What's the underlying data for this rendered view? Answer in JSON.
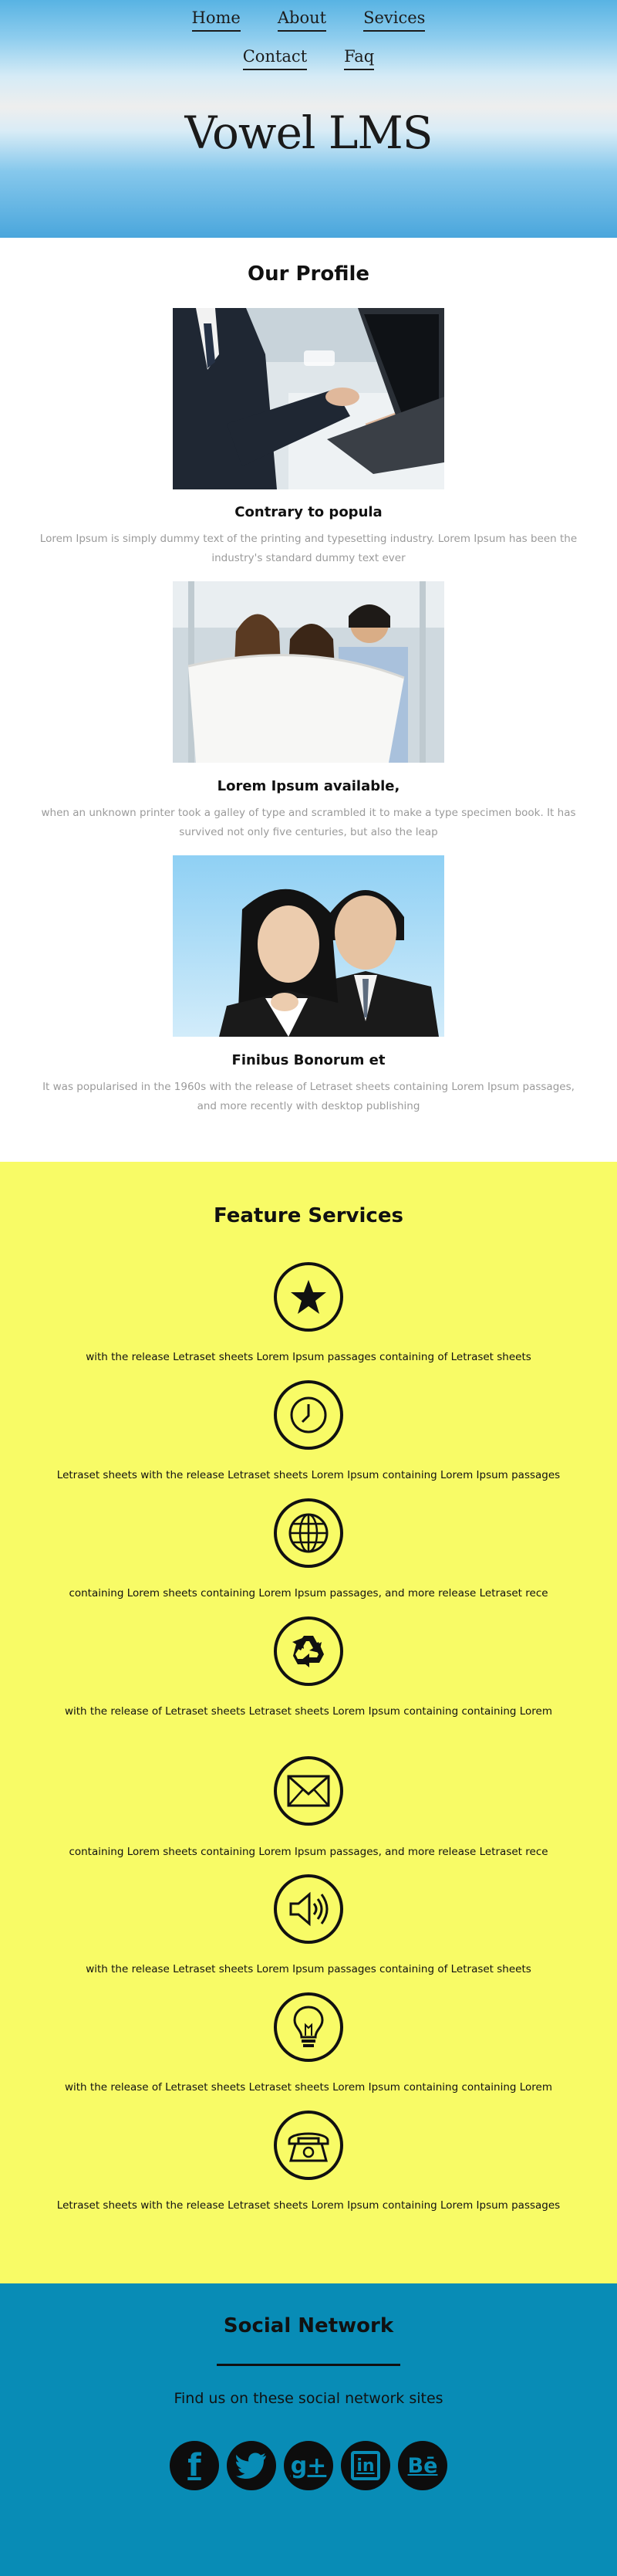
{
  "nav": {
    "row1": [
      {
        "label": "Home"
      },
      {
        "label": "About"
      },
      {
        "label": "Sevices"
      }
    ],
    "row2": [
      {
        "label": "Contact"
      },
      {
        "label": "Faq"
      }
    ]
  },
  "brand": {
    "title": "Vowel LMS"
  },
  "profile": {
    "title": "Our Profile",
    "items": [
      {
        "title": "Contrary to popula",
        "text": "Lorem Ipsum is simply dummy text of the printing and typesetting industry. Lorem Ipsum has been the industry's standard dummy text ever"
      },
      {
        "title": "Lorem Ipsum available,",
        "text": "when an unknown printer took a galley of type and scrambled it to make a type specimen book. It has survived not only five centuries, but also the leap"
      },
      {
        "title": "Finibus Bonorum et",
        "text": "It was popularised in the 1960s with the release of Letraset sheets containing Lorem Ipsum passages, and more recently with desktop publishing"
      }
    ]
  },
  "features": {
    "title": "Feature Services",
    "items": [
      {
        "icon": "star-icon",
        "text": "with the release Letraset sheets Lorem Ipsum passages containing of Letraset sheets"
      },
      {
        "icon": "clock-icon",
        "text": "Letraset sheets with the release Letraset sheets Lorem Ipsum containing Lorem Ipsum passages"
      },
      {
        "icon": "globe-icon",
        "text": "containing Lorem sheets containing Lorem Ipsum passages, and more release Letraset rece"
      },
      {
        "icon": "recycle-icon",
        "text": "with the release of Letraset sheets Letraset sheets Lorem Ipsum containing containing Lorem"
      },
      {
        "icon": "envelope-icon",
        "text": "containing Lorem sheets containing Lorem Ipsum passages, and more release Letraset rece"
      },
      {
        "icon": "speaker-icon",
        "text": "with the release Letraset sheets Lorem Ipsum passages containing of Letraset sheets"
      },
      {
        "icon": "lightbulb-icon",
        "text": "with the release of Letraset sheets Letraset sheets Lorem Ipsum containing containing Lorem"
      },
      {
        "icon": "telephone-icon",
        "text": "Letraset sheets with the release Letraset sheets Lorem Ipsum containing Lorem Ipsum passages"
      }
    ]
  },
  "social": {
    "title": "Social Network",
    "subtitle": "Find us on these social network sites",
    "icons": [
      {
        "icon": "facebook-icon",
        "glyph": "f"
      },
      {
        "icon": "twitter-icon",
        "glyph": ""
      },
      {
        "icon": "google-plus-icon",
        "glyph": "g+"
      },
      {
        "icon": "linkedin-icon",
        "glyph": "in"
      },
      {
        "icon": "behance-icon",
        "glyph": "Bē"
      }
    ]
  },
  "colors": {
    "header_blue": "#4aa6dc",
    "features_bg": "#f8fb66",
    "social_bg": "#088cb6"
  }
}
